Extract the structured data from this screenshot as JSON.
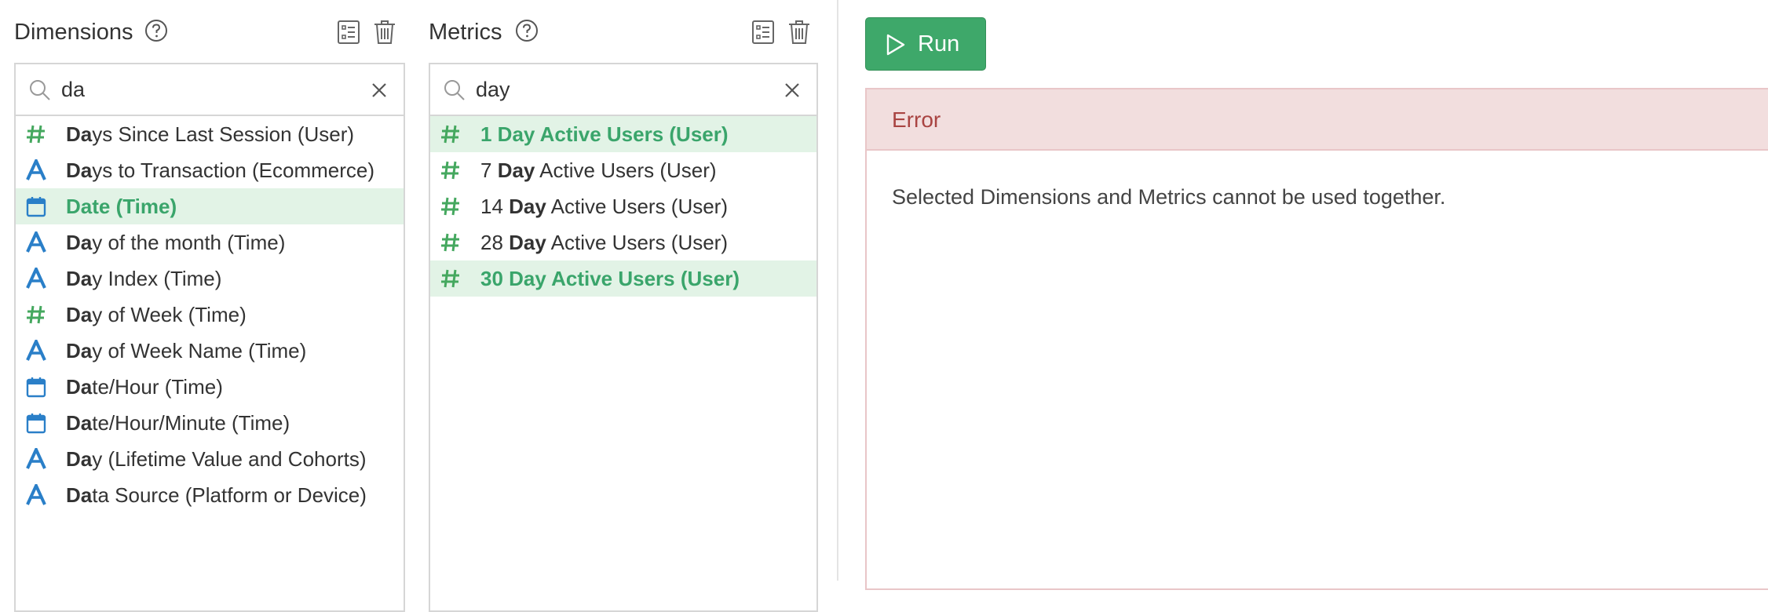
{
  "dimensions": {
    "title": "Dimensions",
    "search": {
      "value": "da",
      "placeholder": ""
    },
    "items": [
      {
        "type": "number",
        "bold": "Da",
        "rest": "ys Since Last Session (User)",
        "selected": false
      },
      {
        "type": "text",
        "bold": "Da",
        "rest": "ys to Transaction (Ecommerce)",
        "selected": false
      },
      {
        "type": "date",
        "bold": "Date (Time)",
        "rest": "",
        "selected": true
      },
      {
        "type": "text",
        "bold": "Da",
        "rest": "y of the month (Time)",
        "selected": false
      },
      {
        "type": "text",
        "bold": "Da",
        "rest": "y Index (Time)",
        "selected": false
      },
      {
        "type": "number",
        "bold": "Da",
        "rest": "y of Week (Time)",
        "selected": false
      },
      {
        "type": "text",
        "bold": "Da",
        "rest": "y of Week Name (Time)",
        "selected": false
      },
      {
        "type": "date",
        "bold": "Da",
        "rest": "te/Hour (Time)",
        "selected": false
      },
      {
        "type": "date",
        "bold": "Da",
        "rest": "te/Hour/Minute (Time)",
        "selected": false
      },
      {
        "type": "text",
        "bold": "Da",
        "rest": "y (Lifetime Value and Cohorts)",
        "selected": false
      },
      {
        "type": "text",
        "bold": "Da",
        "rest": "ta Source (Platform or Device)",
        "selected": false
      }
    ]
  },
  "metrics": {
    "title": "Metrics",
    "search": {
      "value": "day",
      "placeholder": ""
    },
    "items": [
      {
        "type": "number",
        "pre": "",
        "bold": "1 Day Active Users (User)",
        "rest": "",
        "selected": true
      },
      {
        "type": "number",
        "pre": "7 ",
        "bold": "Day",
        "rest": " Active Users (User)",
        "selected": false
      },
      {
        "type": "number",
        "pre": "14 ",
        "bold": "Day",
        "rest": " Active Users (User)",
        "selected": false
      },
      {
        "type": "number",
        "pre": "28 ",
        "bold": "Day",
        "rest": " Active Users (User)",
        "selected": false
      },
      {
        "type": "number",
        "pre": "",
        "bold": "30 Day Active Users (User)",
        "rest": "",
        "selected": true
      }
    ]
  },
  "run_button": {
    "label": "Run"
  },
  "error": {
    "title": "Error",
    "message": "Selected Dimensions and Metrics cannot be used together."
  },
  "colors": {
    "number_icon": "#45a85f",
    "text_icon": "#2a7fc8",
    "date_icon": "#2a7fc8",
    "selected_bg": "#e2f3e6",
    "selected_text": "#3aa56b",
    "run_bg": "#3ea86a",
    "error_bg": "#f2dede",
    "error_text": "#a94442"
  },
  "icons": {
    "help": "question-circle-icon",
    "list": "list-checks-icon",
    "trash": "trash-icon",
    "search": "search-icon",
    "clear": "close-icon",
    "number": "hash-icon",
    "text": "letter-a-icon",
    "date": "calendar-icon",
    "run": "play-icon"
  }
}
